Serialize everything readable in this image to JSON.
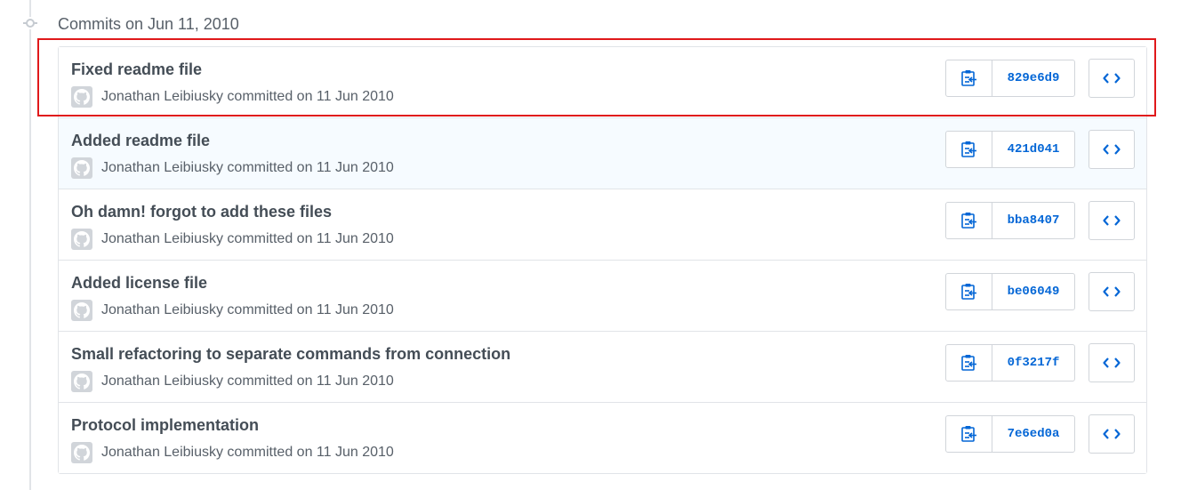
{
  "group": {
    "title": "Commits on Jun 11, 2010"
  },
  "commits": [
    {
      "title": "Fixed readme file",
      "meta": "Jonathan Leibiusky committed on 11 Jun 2010",
      "sha": "829e6d9"
    },
    {
      "title": "Added readme file",
      "meta": "Jonathan Leibiusky committed on 11 Jun 2010",
      "sha": "421d041"
    },
    {
      "title": "Oh damn! forgot to add these files",
      "meta": "Jonathan Leibiusky committed on 11 Jun 2010",
      "sha": "bba8407"
    },
    {
      "title": "Added license file",
      "meta": "Jonathan Leibiusky committed on 11 Jun 2010",
      "sha": "be06049"
    },
    {
      "title": "Small refactoring to separate commands from connection",
      "meta": "Jonathan Leibiusky committed on 11 Jun 2010",
      "sha": "0f3217f"
    },
    {
      "title": "Protocol implementation",
      "meta": "Jonathan Leibiusky committed on 11 Jun 2010",
      "sha": "7e6ed0a"
    }
  ],
  "icons": {
    "timeline": "git-commit-icon",
    "avatar": "github-avatar-icon",
    "copy": "clipboard-copy-icon",
    "browse": "code-brackets-icon"
  },
  "colors": {
    "link": "#0366d6",
    "highlight": "#e0191b",
    "hover_row": "#f6fbff"
  }
}
